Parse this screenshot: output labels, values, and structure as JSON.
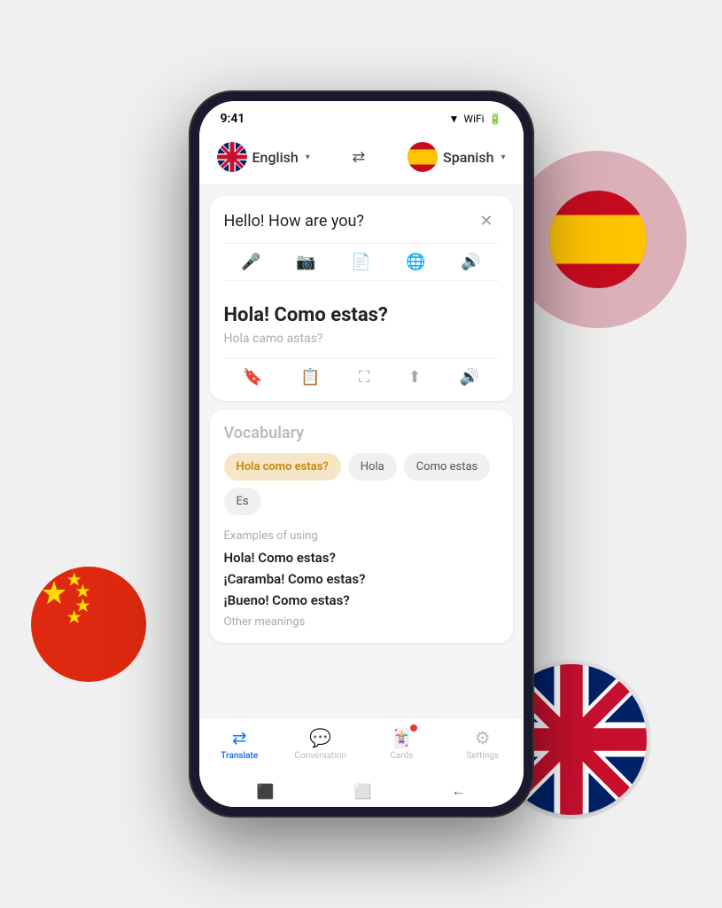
{
  "status_bar": {
    "time": "9:41",
    "signal_icon": "▼▲",
    "wifi_icon": "wifi",
    "battery_icon": "battery"
  },
  "lang_selector": {
    "source_lang": "English",
    "source_flag": "🇬🇧",
    "target_lang": "Spanish",
    "target_flag": "🇪🇸",
    "swap_label": "⇄"
  },
  "translation_input": {
    "text": "Hello! How are you?",
    "close_label": "✕"
  },
  "input_tools": [
    {
      "name": "microphone",
      "icon": "🎤"
    },
    {
      "name": "camera",
      "icon": "📷"
    },
    {
      "name": "document",
      "icon": "📄"
    },
    {
      "name": "globe",
      "icon": "🌐"
    },
    {
      "name": "speaker",
      "icon": "🔊"
    }
  ],
  "translation_output": {
    "text": "Hola! Como estas?",
    "romanization": "Hola camo astas?"
  },
  "output_tools": [
    {
      "name": "bookmark",
      "icon": "🔖"
    },
    {
      "name": "copy",
      "icon": "📋"
    },
    {
      "name": "expand",
      "icon": "⛶"
    },
    {
      "name": "share",
      "icon": "⬆"
    },
    {
      "name": "speaker",
      "icon": "🔊"
    }
  ],
  "vocabulary": {
    "title": "Vocabulary",
    "chips": [
      {
        "label": "Hola como estas?",
        "active": true
      },
      {
        "label": "Hola",
        "active": false
      },
      {
        "label": "Como estas",
        "active": false
      },
      {
        "label": "Es",
        "active": false
      }
    ],
    "examples_label": "Examples of using",
    "examples": [
      "Hola! Como estas?",
      "¡Caramba! Como estas?",
      "¡Bueno! Como estas?"
    ],
    "other_meanings_label": "Other meanings"
  },
  "bottom_nav": {
    "items": [
      {
        "label": "Translate",
        "icon": "⇄",
        "active": true
      },
      {
        "label": "Conversation",
        "icon": "💬",
        "active": false
      },
      {
        "label": "Cards",
        "icon": "🃏",
        "active": false,
        "badge": true
      },
      {
        "label": "Settings",
        "icon": "⚙",
        "active": false
      }
    ]
  },
  "gesture_bar": {
    "back": "←",
    "home": "⬜",
    "recent": "⬛"
  }
}
